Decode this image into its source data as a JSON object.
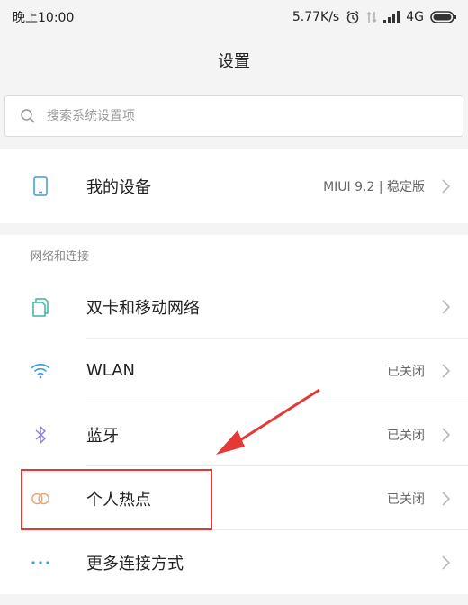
{
  "status_bar": {
    "time": "晚上10:00",
    "speed": "5.77K/s",
    "network": "4G"
  },
  "header": {
    "title": "设置"
  },
  "search": {
    "placeholder": "搜索系统设置项"
  },
  "device": {
    "label": "我的设备",
    "value": "MIUI 9.2 | 稳定版",
    "icon": "phone-icon"
  },
  "network_section": {
    "title": "网络和连接",
    "items": [
      {
        "label": "双卡和移动网络",
        "value": "",
        "icon": "sim-card-icon"
      },
      {
        "label": "WLAN",
        "value": "已关闭",
        "icon": "wifi-icon"
      },
      {
        "label": "蓝牙",
        "value": "已关闭",
        "icon": "bluetooth-icon"
      },
      {
        "label": "个人热点",
        "value": "已关闭",
        "icon": "hotspot-icon"
      },
      {
        "label": "更多连接方式",
        "value": "",
        "icon": "more-dots-icon"
      }
    ]
  },
  "colors": {
    "accent": "#3a9ad9",
    "hotspot_icon": "#e8a070",
    "annotation": "#e53935"
  }
}
